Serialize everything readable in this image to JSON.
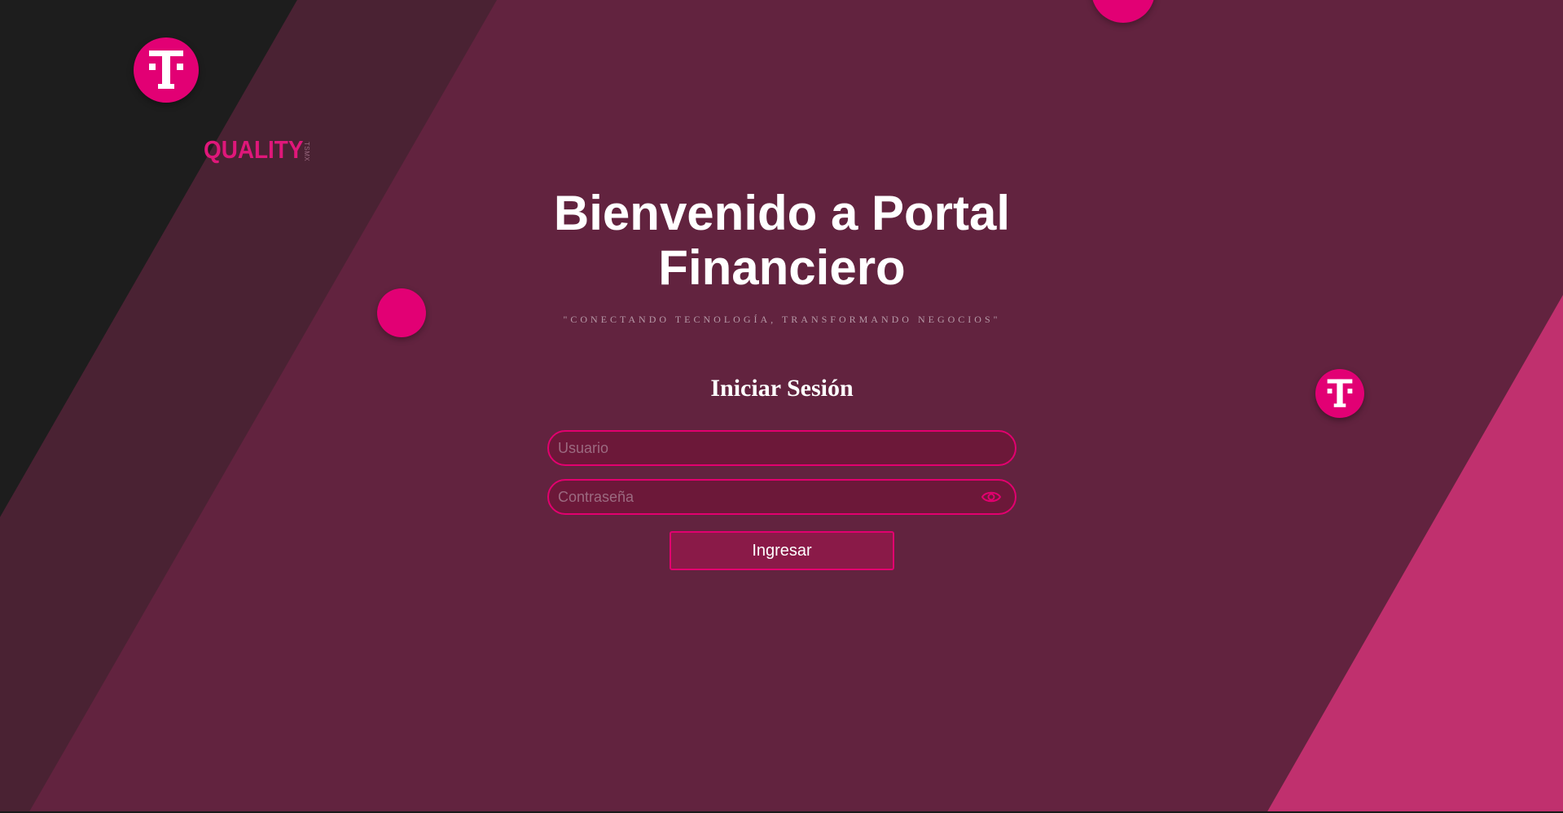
{
  "branding": {
    "logo_icon": "telekom-t-icon",
    "brand_name": "QUALITY",
    "brand_sub": "TSMX",
    "accent_color": "#e20074"
  },
  "hero": {
    "title": "Bienvenido a Portal Financiero",
    "tagline": "\"CONECTANDO TECNOLOGÍA, TRANSFORMANDO NEGOCIOS\""
  },
  "login": {
    "heading": "Iniciar Sesión",
    "username": {
      "value": "",
      "placeholder": "Usuario"
    },
    "password": {
      "value": "",
      "placeholder": "Contraseña",
      "toggle_icon": "eye-icon"
    },
    "submit_label": "Ingresar"
  },
  "colors": {
    "background": "#62233f",
    "dark_band": "#1d1d1d",
    "pink_band": "#c0306e",
    "input_bg": "#6c1839",
    "button_bg": "#8a1a48"
  }
}
